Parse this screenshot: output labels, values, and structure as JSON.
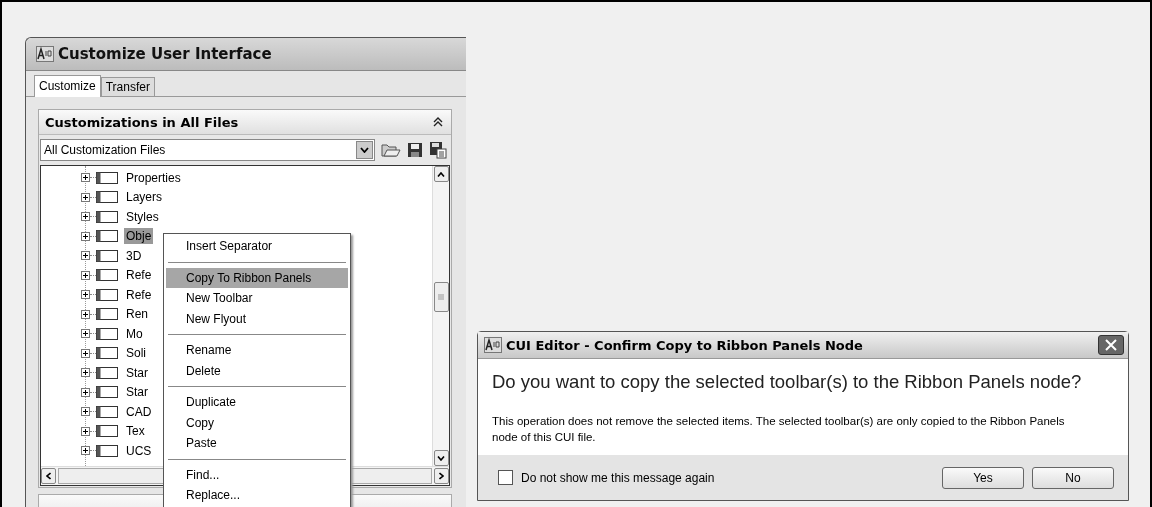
{
  "cui_window": {
    "title": "Customize User Interface",
    "tabs": [
      {
        "label": "Customize",
        "selected": true
      },
      {
        "label": "Transfer",
        "selected": false
      }
    ],
    "panel": {
      "title": "Customizations in All Files",
      "expanded": true,
      "file_filter": "All Customization Files",
      "tree": [
        {
          "label": "Properties",
          "selected": false
        },
        {
          "label": "Layers",
          "selected": false
        },
        {
          "label": "Styles",
          "selected": false
        },
        {
          "label": "Obje",
          "selected": true
        },
        {
          "label": "3D",
          "selected": false
        },
        {
          "label": "Refe",
          "selected": false
        },
        {
          "label": "Refe",
          "selected": false
        },
        {
          "label": "Ren",
          "selected": false
        },
        {
          "label": "Mo",
          "selected": false
        },
        {
          "label": "Soli",
          "selected": false
        },
        {
          "label": "Star",
          "selected": false
        },
        {
          "label": "Star",
          "selected": false
        },
        {
          "label": "CAD",
          "selected": false
        },
        {
          "label": "Tex",
          "selected": false
        },
        {
          "label": "UCS",
          "selected": false
        }
      ]
    }
  },
  "context_menu": {
    "groups": [
      [
        {
          "label": "Insert Separator",
          "selected": false
        }
      ],
      [
        {
          "label": "Copy To Ribbon Panels",
          "selected": true
        },
        {
          "label": "New Toolbar",
          "selected": false
        },
        {
          "label": "New Flyout",
          "selected": false
        }
      ],
      [
        {
          "label": "Rename",
          "selected": false
        },
        {
          "label": "Delete",
          "selected": false
        }
      ],
      [
        {
          "label": "Duplicate",
          "selected": false
        },
        {
          "label": "Copy",
          "selected": false
        },
        {
          "label": "Paste",
          "selected": false
        }
      ],
      [
        {
          "label": "Find...",
          "selected": false
        },
        {
          "label": "Replace...",
          "selected": false
        }
      ]
    ]
  },
  "confirm_dialog": {
    "title": "CUI Editor - Confirm Copy to Ribbon Panels Node",
    "question": "Do you want to copy the selected toolbar(s) to the Ribbon Panels node?",
    "message": "This operation does not remove the selected items. The selected toolbar(s) are only copied to the Ribbon Panels node of this CUI file.",
    "dont_show_again": {
      "label": "Do not show me this message again",
      "checked": false
    },
    "buttons": [
      "Yes",
      "No"
    ]
  }
}
